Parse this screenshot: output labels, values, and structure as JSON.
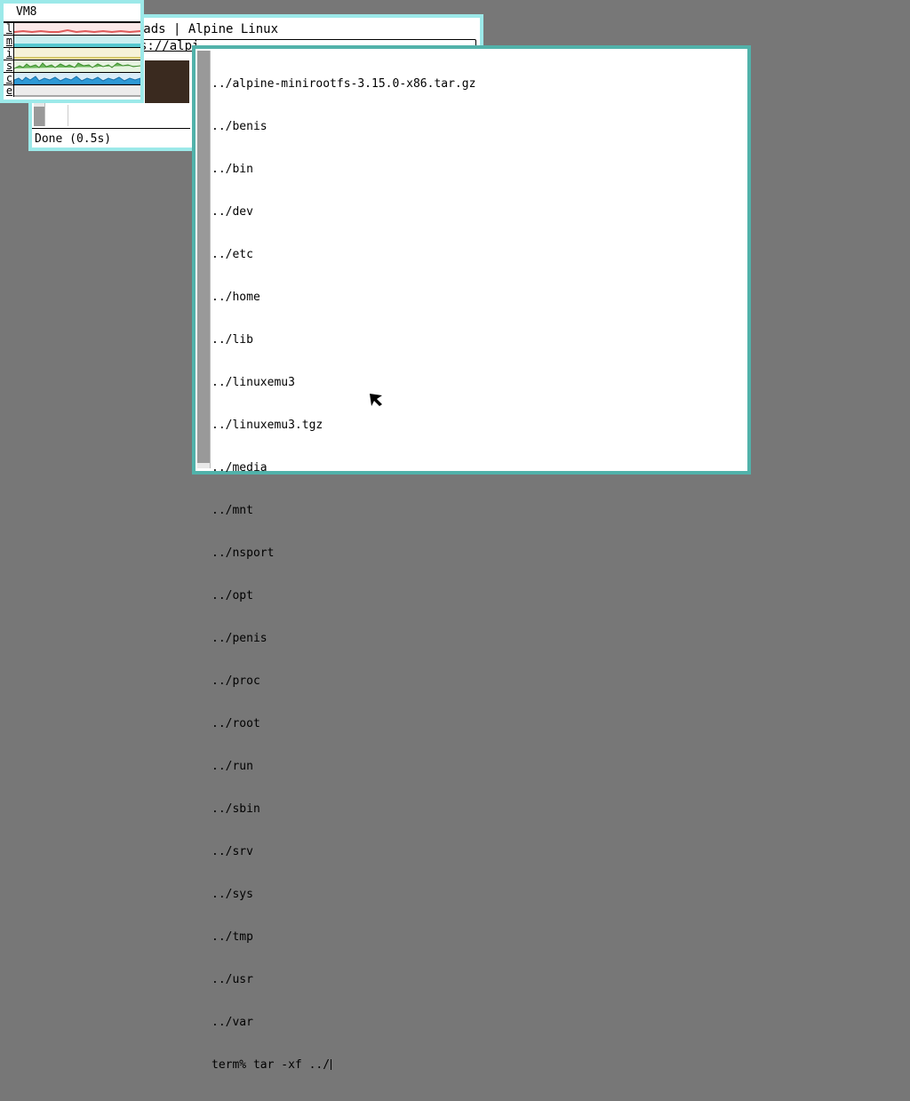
{
  "desktop": {
    "background": "#777777"
  },
  "browser": {
    "title": "mloads | Alpine Linux",
    "url": "s://alpi",
    "status": "Done (0.5s)",
    "border_color": "#9ce9e9"
  },
  "stats": {
    "system_name": "VM8",
    "rows": [
      {
        "label": "l",
        "color": "#e05a5a"
      },
      {
        "label": "m",
        "color": "#58c8d0"
      },
      {
        "label": "i",
        "color": "#d6c86a"
      },
      {
        "label": "s",
        "color": "#6ab85a"
      },
      {
        "label": "c",
        "color": "#2e9ad6"
      },
      {
        "label": "e",
        "color": "#a8a8a8"
      }
    ]
  },
  "terminal": {
    "border_color": "#51b2aa",
    "lines": [
      "../alpine-minirootfs-3.15.0-x86.tar.gz",
      "../benis",
      "../bin",
      "../dev",
      "../etc",
      "../home",
      "../lib",
      "../linuxemu3",
      "../linuxemu3.tgz",
      "../media",
      "../mnt",
      "../nsport",
      "../opt",
      "../penis",
      "../proc",
      "../root",
      "../run",
      "../sbin",
      "../srv",
      "../sys",
      "../tmp",
      "../usr",
      "../var"
    ],
    "prompt": "term% tar -xf ../"
  },
  "cursor": {
    "icon": "arrow-pointer-icon"
  }
}
